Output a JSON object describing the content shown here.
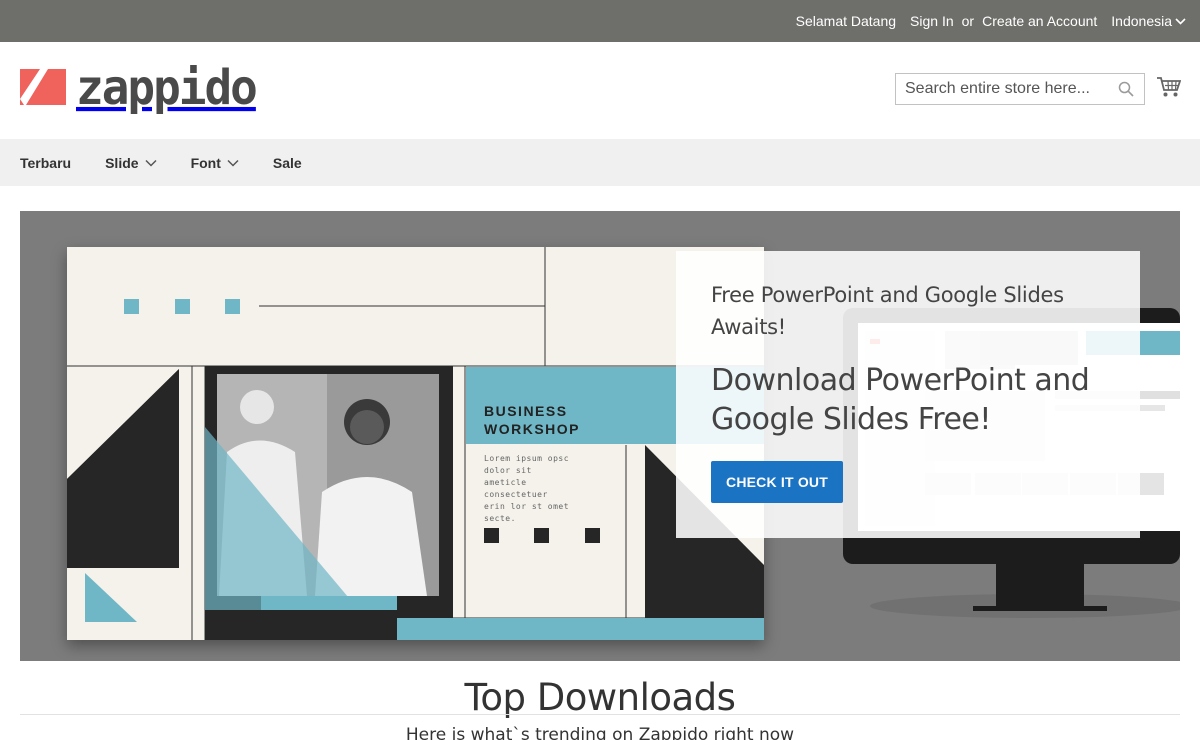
{
  "topbar": {
    "welcome": "Selamat Datang",
    "sign_in": "Sign In",
    "or": "or",
    "create_account": "Create an Account",
    "language": "Indonesia"
  },
  "header": {
    "logo_text": "zappido",
    "search_placeholder": "Search entire store here...",
    "brand_color": "#f0625c"
  },
  "nav": {
    "items": [
      {
        "label": "Terbaru",
        "has_dropdown": false
      },
      {
        "label": "Slide",
        "has_dropdown": true
      },
      {
        "label": "Font",
        "has_dropdown": true
      },
      {
        "label": "Sale",
        "has_dropdown": false
      }
    ]
  },
  "hero": {
    "slide": {
      "title_line1": "BUSINESS",
      "title_line2": "WORKSHOP",
      "lorem": "Lorem ipsum opsc dolor sit ameticle consectetuer erin lor st omet secte.",
      "accent_color": "#6fb7c7"
    },
    "promo": {
      "subtitle": "Free PowerPoint and Google Slides Awaits!",
      "title": "Download PowerPoint and Google Slides Free!",
      "cta": "CHECK IT OUT",
      "cta_color": "#1b73c3"
    }
  },
  "section": {
    "title": "Top Downloads",
    "subtitle": "Here is what`s trending on Zappido right now"
  }
}
